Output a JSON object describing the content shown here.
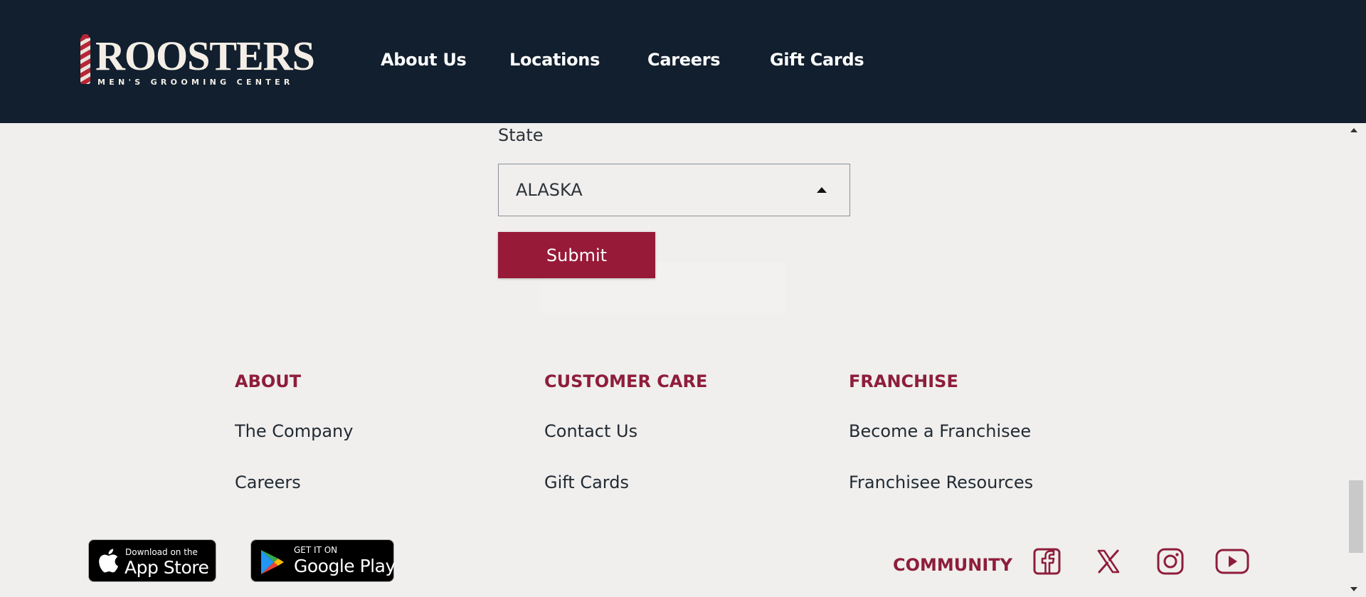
{
  "header": {
    "logo": {
      "wordmark": "ROOSTERS",
      "tagline": "MEN'S GROOMING CENTER"
    },
    "nav": [
      {
        "label": "About Us"
      },
      {
        "label": "Locations"
      },
      {
        "label": "Careers"
      },
      {
        "label": "Gift Cards"
      }
    ]
  },
  "form": {
    "state_label": "State",
    "state_value": "ALASKA",
    "submit_label": "Submit"
  },
  "footer": {
    "columns": [
      {
        "heading": "ABOUT",
        "links": [
          "The Company",
          "Careers"
        ]
      },
      {
        "heading": "CUSTOMER CARE",
        "links": [
          "Contact Us",
          "Gift Cards"
        ]
      },
      {
        "heading": "FRANCHISE",
        "links": [
          "Become a Franchisee",
          "Franchisee Resources"
        ]
      }
    ],
    "app_store": {
      "small": "Download on the",
      "big": "App Store"
    },
    "google_play": {
      "small": "GET IT ON",
      "big": "Google Play"
    },
    "community_label": "COMMUNITY",
    "social_icons": [
      "facebook-icon",
      "x-icon",
      "instagram-icon",
      "youtube-icon"
    ]
  },
  "colors": {
    "header_bg": "#111f2e",
    "brand_red": "#971a38",
    "heading_red": "#8e1d3b",
    "page_bg": "#f0efed"
  }
}
